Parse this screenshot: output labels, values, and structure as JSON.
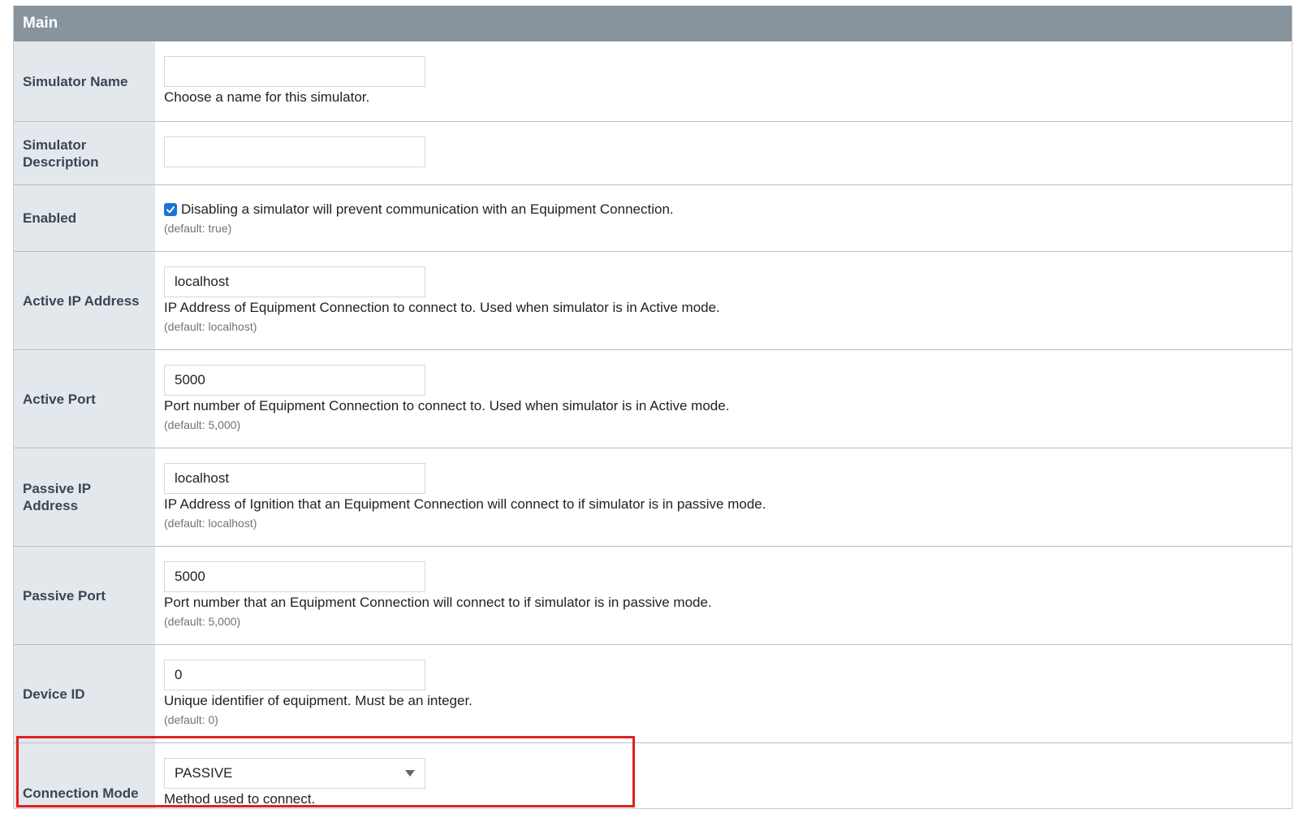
{
  "section": {
    "title": "Main"
  },
  "fields": {
    "simulator_name": {
      "label": "Simulator Name",
      "value": "",
      "description": "Choose a name for this simulator."
    },
    "simulator_description": {
      "label": "Simulator\nDescription",
      "value": ""
    },
    "enabled": {
      "label": "Enabled",
      "checked": true,
      "description": "Disabling a simulator will prevent communication with an Equipment Connection.",
      "default": "(default: true)"
    },
    "active_ip": {
      "label": "Active IP Address",
      "value": "localhost",
      "description": "IP Address of Equipment Connection to connect to. Used when simulator is in Active mode.",
      "default": "(default: localhost)"
    },
    "active_port": {
      "label": "Active Port",
      "value": "5000",
      "description": "Port number of Equipment Connection to connect to. Used when simulator is in Active mode.",
      "default": "(default: 5,000)"
    },
    "passive_ip": {
      "label": "Passive IP\nAddress",
      "value": "localhost",
      "description": "IP Address of Ignition that an Equipment Connection will connect to if simulator is in passive mode.",
      "default": "(default: localhost)"
    },
    "passive_port": {
      "label": "Passive Port",
      "value": "5000",
      "description": "Port number that an Equipment Connection will connect to if simulator is in passive mode.",
      "default": "(default: 5,000)"
    },
    "device_id": {
      "label": "Device ID",
      "value": "0",
      "description": "Unique identifier of equipment. Must be an integer.",
      "default": "(default: 0)"
    },
    "connection_mode": {
      "label": "Connection Mode",
      "value": "PASSIVE",
      "description": "Method used to connect."
    }
  },
  "colors": {
    "header_bg": "#87939d",
    "label_bg": "#e3e8ed",
    "checkbox": "#1a73d9",
    "highlight": "#e02020"
  }
}
